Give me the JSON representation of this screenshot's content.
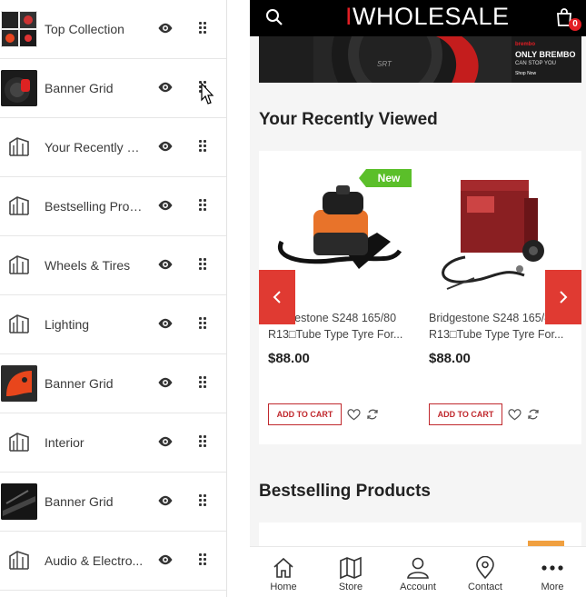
{
  "sidebar": {
    "items": [
      {
        "label": "Top Collection",
        "thumb": "photo-collage"
      },
      {
        "label": "Banner Grid",
        "thumb": "photo-brake"
      },
      {
        "label": "Your Recently Vi...",
        "thumb": "section-icon"
      },
      {
        "label": "Bestselling Prod...",
        "thumb": "section-icon"
      },
      {
        "label": "Wheels & Tires",
        "thumb": "section-icon"
      },
      {
        "label": "Lighting",
        "thumb": "section-icon"
      },
      {
        "label": "Banner Grid",
        "thumb": "photo-caliper"
      },
      {
        "label": "Interior",
        "thumb": "section-icon"
      },
      {
        "label": "Banner Grid",
        "thumb": "photo-interior"
      },
      {
        "label": "Audio & Electro...",
        "thumb": "section-icon"
      }
    ]
  },
  "store": {
    "brand": "WHOLESALE",
    "cart_count": "0",
    "banner": {
      "small_brand": "brembo",
      "headline": "ONLY BREMBO",
      "subline": "CAN STOP YOU",
      "cta": "Shop Now"
    },
    "recently_viewed_title": "Your Recently Viewed",
    "products": [
      {
        "tag": "New",
        "title": "Bridgestone S248 165/80 R13□Tube Type Tyre For...",
        "price": "$88.00",
        "add_label": "ADD TO CART"
      },
      {
        "tag": "",
        "title": "Bridgestone S248 165/80 R13□Tube Type Tyre For...",
        "price": "$88.00",
        "add_label": "ADD TO CART"
      }
    ],
    "bestselling_title": "Bestselling Products",
    "nav": [
      {
        "label": "Home",
        "icon": "home-icon"
      },
      {
        "label": "Store",
        "icon": "map-icon"
      },
      {
        "label": "Account",
        "icon": "user-icon"
      },
      {
        "label": "Contact",
        "icon": "location-pin-icon"
      },
      {
        "label": "More",
        "icon": "dots-icon"
      }
    ]
  },
  "colors": {
    "accent": "#e31e24",
    "new_tag": "#5bbf2a",
    "topbar": "#000000"
  }
}
